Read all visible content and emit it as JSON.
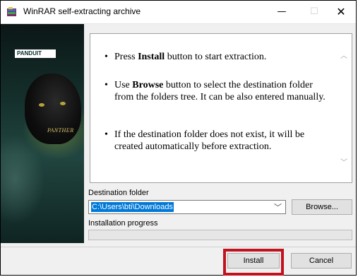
{
  "window": {
    "title": "WinRAR self-extracting archive",
    "controls": {
      "minimize": "—",
      "maximize": "☐",
      "close": "✕"
    }
  },
  "side_image": {
    "logo_text": "PANDUIT",
    "caption": "PANTHER"
  },
  "instructions": {
    "bullet1": {
      "pre": "Press ",
      "bold": "Install",
      "post": " button to start extraction."
    },
    "bullet2": {
      "pre": "Use ",
      "bold": "Browse",
      "post": " button to select the destination folder from the folders tree. It can be also entered manually."
    },
    "bullet3": {
      "text": "If the destination folder does not exist, it will be created automatically before extraction."
    }
  },
  "destination": {
    "label": "Destination folder",
    "value": "C:\\Users\\bti\\Downloads",
    "browse_label": "Browse..."
  },
  "progress": {
    "label": "Installation progress",
    "value_pct": 0
  },
  "footer": {
    "install_label": "Install",
    "cancel_label": "Cancel"
  },
  "colors": {
    "selection": "#0078d7",
    "highlight_box": "#c1121f"
  }
}
